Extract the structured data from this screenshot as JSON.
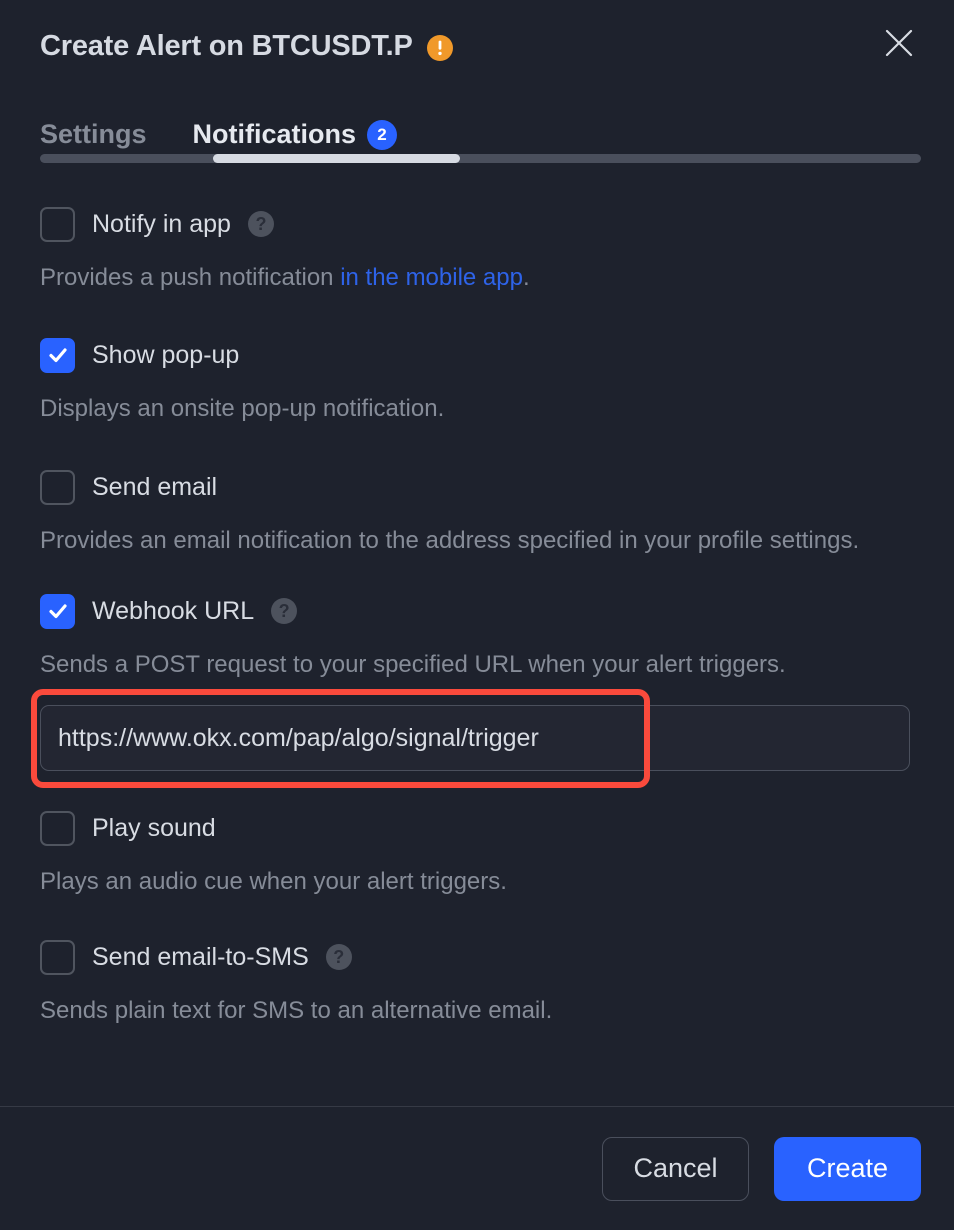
{
  "dialog": {
    "title": "Create Alert on BTCUSDT.P",
    "warning_icon": "warning-exclamation-icon",
    "close_icon": "close-icon"
  },
  "tabs": [
    {
      "label": "Settings",
      "active": false,
      "badge": null
    },
    {
      "label": "Notifications",
      "active": true,
      "badge": "2"
    }
  ],
  "options": [
    {
      "key": "notify_in_app",
      "label": "Notify in app",
      "checked": false,
      "help": "?",
      "desc_before": "Provides a push notification ",
      "desc_link": "in the mobile app",
      "desc_after": "."
    },
    {
      "key": "show_popup",
      "label": "Show pop-up",
      "checked": true,
      "help": null,
      "desc_before": "Displays an onsite pop-up notification.",
      "desc_link": null,
      "desc_after": ""
    },
    {
      "key": "send_email",
      "label": "Send email",
      "checked": false,
      "help": null,
      "desc_before": "Provides an email notification to the address specified in your profile settings.",
      "desc_link": null,
      "desc_after": ""
    },
    {
      "key": "webhook_url",
      "label": "Webhook URL",
      "checked": true,
      "help": "?",
      "desc_before": "Sends a POST request to your specified URL when your alert triggers.",
      "desc_link": null,
      "desc_after": ""
    },
    {
      "key": "play_sound",
      "label": "Play sound",
      "checked": false,
      "help": null,
      "desc_before": "Plays an audio cue when your alert triggers.",
      "desc_link": null,
      "desc_after": ""
    },
    {
      "key": "send_email_to_sms",
      "label": "Send email-to-SMS",
      "checked": false,
      "help": "?",
      "desc_before": "Sends plain text for SMS to an alternative email.",
      "desc_link": null,
      "desc_after": ""
    }
  ],
  "webhook": {
    "value": "https://www.okx.com/pap/algo/signal/trigger",
    "placeholder": "https://"
  },
  "footer": {
    "cancel_label": "Cancel",
    "create_label": "Create"
  },
  "colors": {
    "background": "#1e222d",
    "accent_blue": "#2962ff",
    "warning_orange": "#f0992a",
    "highlight_red": "#fa4a3c",
    "text_primary": "#d8dce3",
    "text_secondary": "#868c98"
  }
}
